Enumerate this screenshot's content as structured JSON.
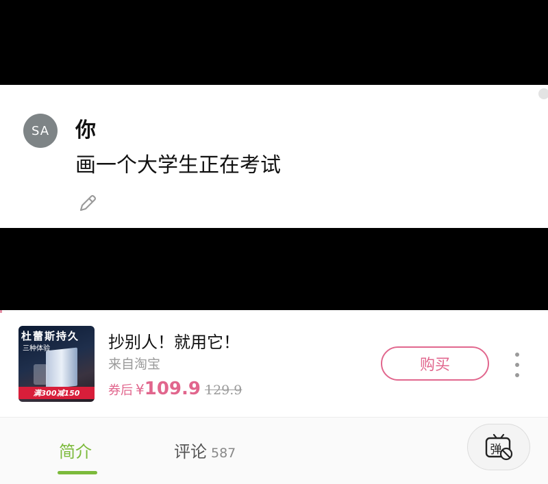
{
  "chat": {
    "avatar_initials": "SA",
    "sender": "你",
    "message": "画一个大学生正在考试",
    "edit_icon": "pencil-icon"
  },
  "ad": {
    "thumbnail": {
      "title": "杜蕾斯持久",
      "subtitle": "三种体验",
      "promo": "满300减150"
    },
    "title": "抄别人！就用它！",
    "source": "来自淘宝",
    "price_label": "券后",
    "currency": "¥",
    "price": "109.9",
    "original_price": "129.9",
    "buy_label": "购买",
    "more_icon": "more-vertical-icon",
    "accent_color": "#e1668d"
  },
  "tabs": {
    "intro_label": "简介",
    "comments_label": "评论",
    "comments_count": "587",
    "active_color": "#7cba3b",
    "danmaku_icon": "danmaku-off-icon",
    "danmaku_glyph": "弹"
  }
}
